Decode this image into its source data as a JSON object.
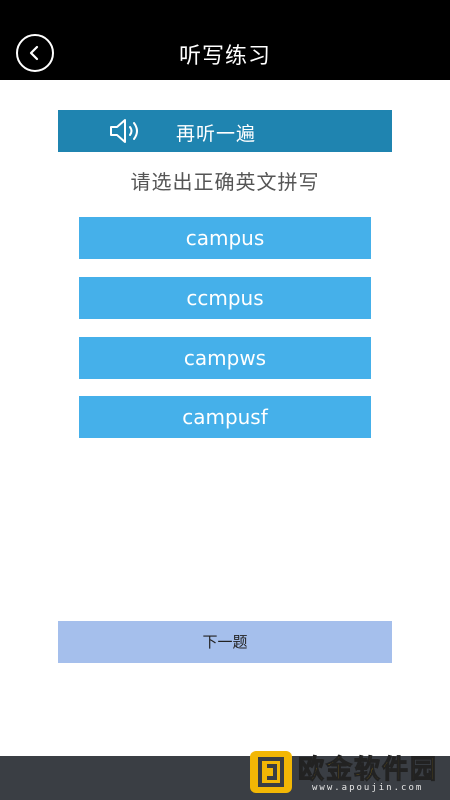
{
  "header": {
    "title": "听写练习",
    "back_icon": "chevron-left-icon"
  },
  "replay": {
    "label": "再听一遍",
    "icon": "speaker-icon"
  },
  "prompt": "请选出正确英文拼写",
  "options": [
    "campus",
    "ccmpus",
    "campws",
    "campusf"
  ],
  "next_label": "下一题",
  "watermark": {
    "text": "欧金软件园",
    "url": "www.apoujin.com"
  },
  "colors": {
    "topbar": "#000000",
    "replay_bg": "#1f84b0",
    "option_bg": "#45b0ea",
    "next_bg": "#a5bfec",
    "watermark": "#f2b705"
  }
}
